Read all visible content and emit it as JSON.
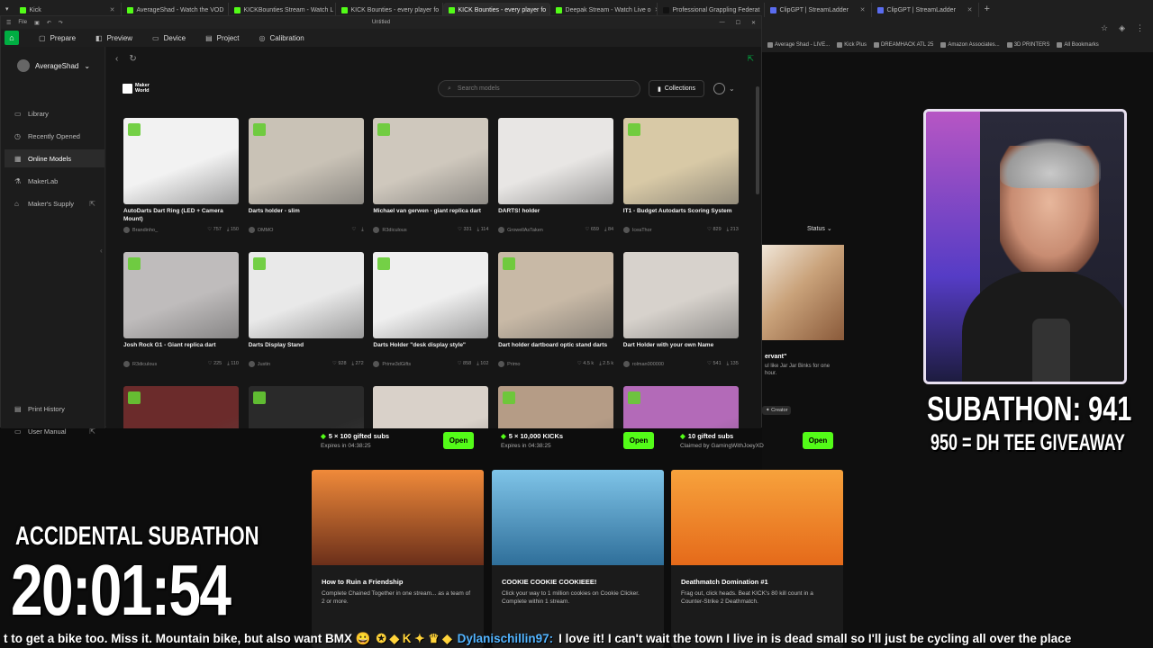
{
  "browser": {
    "tabs": [
      {
        "label": "Kick",
        "active": false
      },
      {
        "label": "AverageShad - Watch the VOD",
        "active": false
      },
      {
        "label": "KICKBounties Stream - Watch L",
        "active": false
      },
      {
        "label": "KICK Bounties - every player fo",
        "active": false
      },
      {
        "label": "KICK Bounties - every player fo",
        "active": true
      },
      {
        "label": "Deepak Stream - Watch Live o",
        "active": false
      },
      {
        "label": "Professional Grappling Federat",
        "active": false
      },
      {
        "label": "ClipGPT | StreamLadder",
        "active": false
      },
      {
        "label": "ClipGPT | StreamLadder",
        "active": false
      }
    ],
    "new_tab": "+",
    "bookmarks": [
      "Average Shad - LIVE...",
      "Kick Plus",
      "DREAMHACK ATL 25",
      "Amazon Associates...",
      "3D PRINTERS",
      "All Bookmarks"
    ]
  },
  "app": {
    "window_title": "Untitled",
    "file_menu": "File",
    "nav": [
      {
        "label": "Prepare",
        "icon": "cube-icon"
      },
      {
        "label": "Preview",
        "icon": "layers-icon"
      },
      {
        "label": "Device",
        "icon": "monitor-icon"
      },
      {
        "label": "Project",
        "icon": "project-icon"
      },
      {
        "label": "Calibration",
        "icon": "calibration-icon"
      }
    ],
    "user": "AverageShad",
    "sidebar": [
      {
        "label": "Library",
        "active": false
      },
      {
        "label": "Recently Opened",
        "active": false
      },
      {
        "label": "Online Models",
        "active": true
      },
      {
        "label": "MakerLab",
        "active": false
      },
      {
        "label": "Maker's Supply",
        "active": false
      }
    ],
    "sidebar_bottom": [
      {
        "label": "Print History"
      },
      {
        "label": "User Manual"
      }
    ],
    "logo_line1": "Maker",
    "logo_line2": "World",
    "search_placeholder": "Search models",
    "collections_label": "Collections",
    "models": [
      {
        "name": "AutoDarts Dart Ring (LED + Camera Mount)",
        "author": "Brandinho_",
        "likes": "757",
        "downloads": "150",
        "color": "#f2f2f2"
      },
      {
        "name": "Darts holder - slim",
        "author": "OMMO",
        "likes": "",
        "downloads": "",
        "color": "#c9c2b6"
      },
      {
        "name": "Michael van gerwen - giant replica dart",
        "author": "R3diculous",
        "likes": "331",
        "downloads": "114",
        "color": "#cfc8bd"
      },
      {
        "name": "DARTS! holder",
        "author": "GrowellAsTaken",
        "likes": "659",
        "downloads": "84",
        "color": "#e8e6e4"
      },
      {
        "name": "IT1 - Budget Autodarts Scoring System",
        "author": "IceaThor",
        "likes": "829",
        "downloads": "213",
        "color": "#d8c9a6"
      },
      {
        "name": "Josh Rock G1 - Giant replica dart",
        "author": "R3diculous",
        "likes": "225",
        "downloads": "110",
        "color": "#bfbcbc"
      },
      {
        "name": "Darts Display Stand",
        "author": "Justin",
        "likes": "928",
        "downloads": "272",
        "color": "#e9e9e9"
      },
      {
        "name": "Darts Holder \"desk display style\"",
        "author": "Prime3dGifts",
        "likes": "858",
        "downloads": "102",
        "color": "#efefef"
      },
      {
        "name": "Dart holder dartboard optic stand darts",
        "author": "Primo",
        "likes": "4.5 k",
        "downloads": "2.5 k",
        "color": "#c8b9a6"
      },
      {
        "name": "Dart Holder with your own Name",
        "author": "rolman000000",
        "likes": "541",
        "downloads": "135",
        "color": "#d7d2cc"
      },
      {
        "name": "",
        "author": "",
        "likes": "",
        "downloads": "",
        "color": "#6b2b2b"
      },
      {
        "name": "",
        "author": "",
        "likes": "",
        "downloads": "",
        "color": "#2a2a2a"
      },
      {
        "name": "",
        "author": "",
        "likes": "",
        "downloads": "",
        "color": "#d9d1c9"
      },
      {
        "name": "",
        "author": "",
        "likes": "",
        "downloads": "",
        "color": "#b59c86"
      },
      {
        "name": "",
        "author": "",
        "likes": "",
        "downloads": "",
        "color": "#b36ab8"
      }
    ]
  },
  "kick": {
    "status_label": "Status",
    "side_card_title": "ervant\"",
    "side_card_desc": "ul like Jar Jar Binks for one hour.",
    "side_card_badge": "Creator",
    "drops": [
      {
        "title": "5 × 100 gifted subs",
        "sub": "Expires in 04:38:25",
        "button": "Open"
      },
      {
        "title": "5 × 10,000 KICKs",
        "sub": "Expires in 04:38:25",
        "button": "Open"
      },
      {
        "title": "10 gifted subs",
        "sub": "Claimed by GamingWithJoeyXD",
        "button": "Open"
      }
    ],
    "bounties": [
      {
        "title": "How to Ruin a Friendship",
        "desc": "Complete Chained Together in one stream... as a team of 2 or more.",
        "color1": "#f08a3a",
        "color2": "#6b2f1a"
      },
      {
        "title": "COOKIE COOKIE COOKIEEE!",
        "desc": "Click your way to 1 million cookies on Cookie Clicker. Complete within 1 stream.",
        "color1": "#7fc4e8",
        "color2": "#2f6f9a"
      },
      {
        "title": "Deathmatch Domination #1",
        "desc": "Frag out, click heads. Beat KICK's 80 kill count in a Counter-Strike 2 Deathmatch.",
        "color1": "#f7a23c",
        "color2": "#e56a1a"
      }
    ]
  },
  "overlay": {
    "subathon_count": "SUBATHON: 941",
    "giveaway": "950 = DH TEE GIVEAWAY",
    "accidental": "ACCIDENTAL SUBATHON",
    "timer": "20:01:54",
    "ticker_part1": "t to get a bike too. Miss it. Mountain bike, but also want BMX 😀",
    "ticker_user": "Dylanischillin97:",
    "ticker_part2": "I love it! I can't wait the town I live in is dead small so I'll just be cycling all over the place"
  }
}
